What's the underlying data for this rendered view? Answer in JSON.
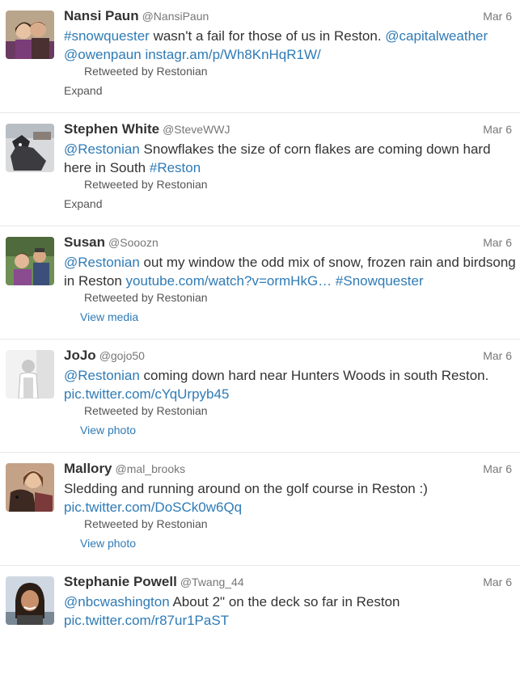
{
  "tweets": [
    {
      "name": "Nansi Paun",
      "handle": "@NansiPaun",
      "date": "Mar 6",
      "avatar": "avatar-couple",
      "text": [
        {
          "t": "#snowquester",
          "link": true
        },
        {
          "t": " wasn't a fail for those of us in Reston. ",
          "link": false
        },
        {
          "t": "@capitalweather",
          "link": true
        },
        {
          "t": " ",
          "link": false
        },
        {
          "t": "@owenpaun",
          "link": true
        },
        {
          "t": " ",
          "link": false
        },
        {
          "t": "instagr.am/p/Wh8KnHqR1W/",
          "link": true
        }
      ],
      "retweet": "Retweeted by Restonian",
      "action": "Expand",
      "action_type": "expand"
    },
    {
      "name": "Stephen White",
      "handle": "@SteveWWJ",
      "date": "Mar 6",
      "avatar": "avatar-dog",
      "text": [
        {
          "t": "@Restonian",
          "link": true
        },
        {
          "t": " Snowflakes the size of corn flakes are coming down hard here in South ",
          "link": false
        },
        {
          "t": "#Reston",
          "link": true
        }
      ],
      "retweet": "Retweeted by Restonian",
      "action": "Expand",
      "action_type": "expand"
    },
    {
      "name": "Susan",
      "handle": "@Sooozn",
      "date": "Mar 6",
      "avatar": "avatar-pair",
      "text": [
        {
          "t": "@Restonian",
          "link": true
        },
        {
          "t": " out my window the odd mix of snow, frozen rain and birdsong in Reston ",
          "link": false
        },
        {
          "t": "youtube.com/watch?v=ormHkG…",
          "link": true
        },
        {
          "t": " ",
          "link": false
        },
        {
          "t": "#Snowquester",
          "link": true
        }
      ],
      "retweet": "Retweeted by Restonian",
      "action": "View media",
      "action_type": "media"
    },
    {
      "name": "JoJo",
      "handle": "@gojo50",
      "date": "Mar 6",
      "avatar": "avatar-bw",
      "text": [
        {
          "t": "@Restonian",
          "link": true
        },
        {
          "t": " coming down hard near Hunters Woods in south Reston. ",
          "link": false
        },
        {
          "t": "pic.twitter.com/cYqUrpyb45",
          "link": true
        }
      ],
      "retweet": "Retweeted by Restonian",
      "action": "View photo",
      "action_type": "media"
    },
    {
      "name": "Mallory",
      "handle": "@mal_brooks",
      "date": "Mar 6",
      "avatar": "avatar-puppy",
      "text": [
        {
          "t": "Sledding and running around on the golf course in Reston :) ",
          "link": false
        },
        {
          "t": "pic.twitter.com/DoSCk0w6Qq",
          "link": true
        }
      ],
      "retweet": "Retweeted by Restonian",
      "action": "View photo",
      "action_type": "media"
    },
    {
      "name": "Stephanie Powell",
      "handle": "@Twang_44",
      "date": "Mar 6",
      "avatar": "avatar-woman",
      "text": [
        {
          "t": "@nbcwashington",
          "link": true
        },
        {
          "t": " About 2\" on the deck so far in Reston ",
          "link": false
        },
        {
          "t": "pic.twitter.com/r87ur1PaST",
          "link": true
        }
      ],
      "retweet": "",
      "action": "",
      "action_type": ""
    }
  ]
}
